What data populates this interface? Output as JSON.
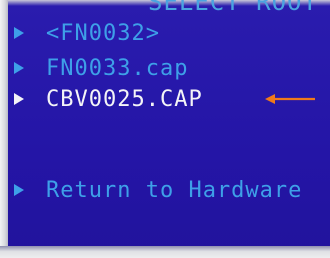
{
  "header_fragment": "SELECT ROOT",
  "menu": {
    "items": [
      {
        "label": "<FN0032>",
        "selected": false
      },
      {
        "label": "FN0033.cap",
        "selected": false
      },
      {
        "label": "CBV0025.CAP",
        "selected": true
      }
    ],
    "return_item": {
      "label": "Return to Hardware"
    }
  },
  "colors": {
    "background": "#2a1cae",
    "item_text": "#3ea0e8",
    "selected_text": "#f4f4f7",
    "annotation_arrow": "#f07a1a"
  },
  "icons": {
    "item_marker": "triangle-right-icon",
    "annotation": "orange-arrow-left-icon"
  }
}
